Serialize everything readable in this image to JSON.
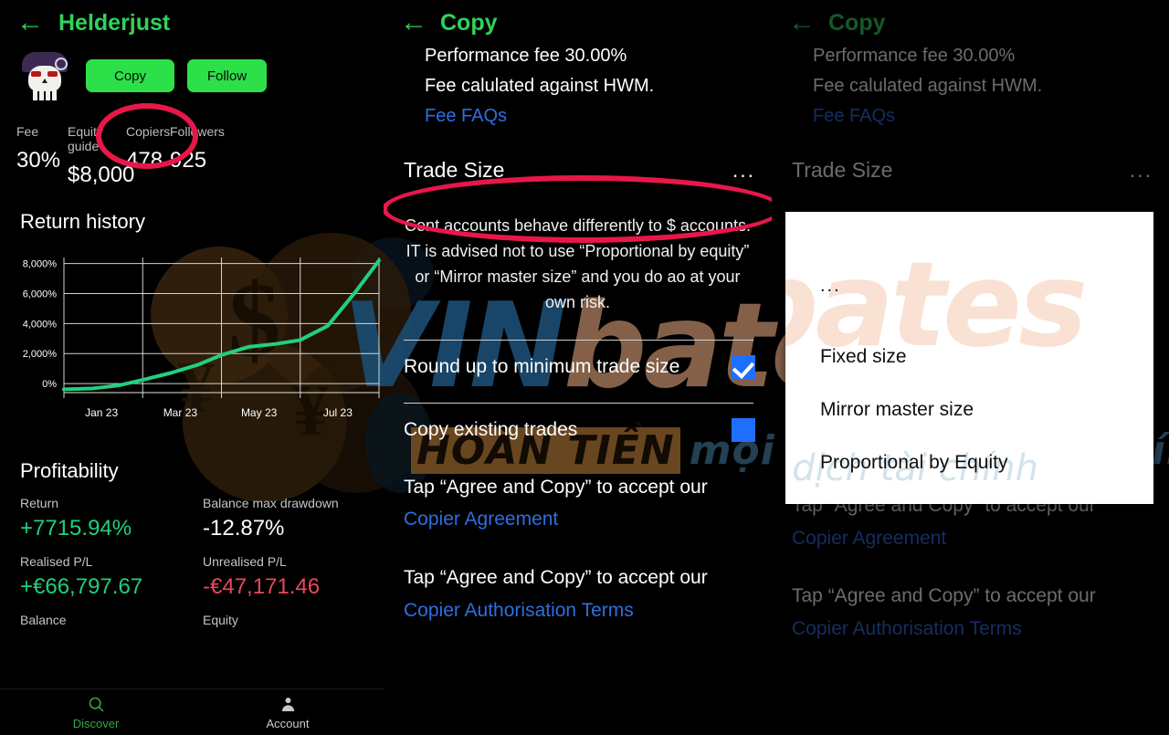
{
  "profile": {
    "back_icon": "back-arrow-icon",
    "title": "Helderjust",
    "avatar_icon": "skull-avatar",
    "copy_label": "Copy",
    "follow_label": "Follow",
    "stats": [
      {
        "key": "Fee",
        "value": "30%"
      },
      {
        "key": "Equity guide",
        "value": "$8,000"
      },
      {
        "key": "Copiers",
        "value": "478"
      },
      {
        "key": "Followers",
        "value": "925"
      }
    ],
    "return_history_title": "Return history",
    "profitability_title": "Profitability",
    "profitability": [
      {
        "key": "Return",
        "value": "+7715.94%",
        "tone": "green"
      },
      {
        "key": "Balance max drawdown",
        "value": "-12.87%",
        "tone": "white"
      },
      {
        "key": "Realised P/L",
        "value": "+€66,797.67",
        "tone": "green"
      },
      {
        "key": "Unrealised P/L",
        "value": "-€47,171.46",
        "tone": "red"
      },
      {
        "key": "Balance",
        "value": "",
        "tone": "white"
      },
      {
        "key": "Equity",
        "value": "",
        "tone": "white"
      }
    ],
    "tabs": [
      {
        "label": "Discover",
        "icon": "search-icon",
        "active": true
      },
      {
        "label": "Account",
        "icon": "person-icon",
        "active": false
      }
    ]
  },
  "chart_data": {
    "type": "line",
    "title": "Return history",
    "xlabel": "",
    "ylabel": "",
    "ylim": [
      -600,
      8400
    ],
    "yticks": [
      0,
      2000,
      4000,
      6000,
      8000
    ],
    "ytick_labels": [
      "0%",
      "2,000%",
      "4,000%",
      "6,000%",
      "8,000%"
    ],
    "categories": [
      "Jan 23",
      "Mar 23",
      "May 23",
      "Jul 23"
    ],
    "grid": true,
    "legend": "none",
    "series": [
      {
        "name": "Return",
        "color": "#21d07e",
        "x": [
          0,
          0.35,
          0.7,
          1.0,
          1.35,
          1.7,
          2.0,
          2.35,
          2.7,
          3.0,
          3.35,
          3.7,
          4.0
        ],
        "values": [
          -380,
          -330,
          -120,
          250,
          700,
          1250,
          1900,
          2450,
          2650,
          2900,
          3850,
          6100,
          8200
        ]
      }
    ]
  },
  "copy_panel": {
    "back_icon": "back-arrow-icon",
    "title": "Copy",
    "performance_fee": "Performance fee 30.00%",
    "fee_note": "Fee calulated against HWM.",
    "fee_faqs": "Fee FAQs",
    "trade_size_label": "Trade Size",
    "trade_size_value": "...",
    "note": "Cent accounts behave differently to $ accounts. IT is advised not to use “Proportional by equity” or “Mirror master size” and you do ao at your own risk.",
    "options": [
      {
        "label": "Round up to minimum trade size",
        "checked": true
      },
      {
        "label": "Copy existing trades",
        "checked": false
      }
    ],
    "agreements": [
      {
        "prefix": "Tap “Agree and Copy” to accept our ",
        "link": "Copier Agreement"
      },
      {
        "prefix": "Tap “Agree and Copy” to accept our ",
        "link": "Copier Authorisation Terms"
      }
    ]
  },
  "dropdown_panel": {
    "back_icon": "back-arrow-icon",
    "title": "Copy",
    "performance_fee": "Performance fee 30.00%",
    "fee_note": "Fee calulated against HWM.",
    "fee_faqs": "Fee FAQs",
    "trade_size_label": "Trade Size",
    "trade_size_value": "...",
    "dropdown_options": [
      {
        "label": "..."
      },
      {
        "label": "Fixed size"
      },
      {
        "label": "Mirror master size"
      },
      {
        "label": "Proportional by Equity"
      }
    ],
    "agreements": [
      {
        "prefix": "Tap “Agree and Copy” to accept our ",
        "link": "Copier Agreement"
      },
      {
        "prefix": "Tap “Agree and Copy” to accept our ",
        "link": "Copier Authorisation Terms"
      }
    ]
  },
  "watermark": {
    "word_left": "VIN",
    "word_right": "bates",
    "sub_highlight": "HOÀN TIỀN",
    "sub_rest": "mọi giao dịch tài chính",
    "dd_sub": "o dịch tài chính"
  },
  "colors": {
    "accent_green": "#2fd35a",
    "button_green": "#2de04a",
    "link_blue": "#2f6ee0",
    "checkbox_blue": "#1f6fff",
    "highlight_red": "#e8174a",
    "positive": "#1fd07a",
    "negative": "#e8485c",
    "chart_line": "#21d07e",
    "background": "#000000"
  }
}
